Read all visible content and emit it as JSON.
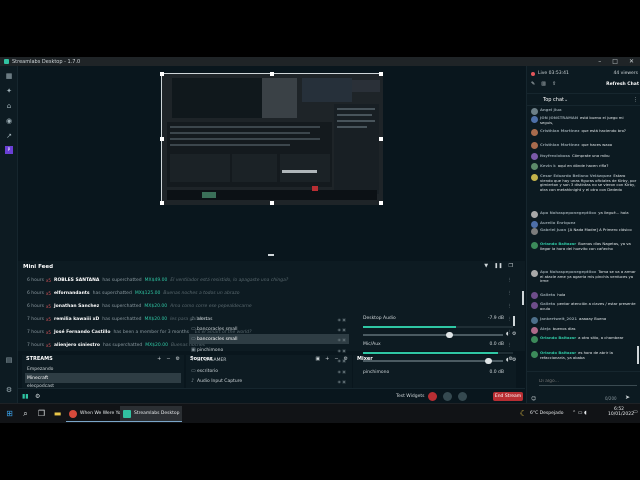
{
  "window": {
    "title": "Streamlabs Desktop - 1.7.0"
  },
  "leftnav": {
    "icons": [
      "editor-icon",
      "themes-icon",
      "store-icon",
      "record-icon",
      "stats-icon",
      "prime-icon",
      "chat-icon",
      "settings-icon"
    ]
  },
  "minifeed": {
    "title": "Mini Feed",
    "rows": [
      {
        "time": "6 hours",
        "badge": "x5",
        "name": "ROBLES SANTANA",
        "action": "has superchatted",
        "amount": "MX$49.00",
        "message": "El ventilador está resistido, lo apagaste una chinga?"
      },
      {
        "time": "6 hours",
        "badge": "x5",
        "name": "elfornandants",
        "action": "has superchatted",
        "amount": "MX$125.00",
        "message": "Buenas noches a todos un abrazo"
      },
      {
        "time": "6 hours",
        "badge": "x5",
        "name": "Jonathan Sanchez",
        "action": "has superchatted",
        "amount": "MX$20.00",
        "message": "Ama como corre ese pepealdecarne"
      },
      {
        "time": "7 hours",
        "badge": "x5",
        "name": "remilia kawaiii xD",
        "action": "has superchatted",
        "amount": "MX$20.00",
        "message": "les para galletas"
      },
      {
        "time": "7 hours",
        "badge": "x5",
        "name": "José Fernando Castillo",
        "action": "has been a member for 3 months",
        "amount": "",
        "message": "Es el Smart of the world?"
      },
      {
        "time": "7 hours",
        "badge": "x5",
        "name": "alienjero siniestro",
        "action": "has superchatted",
        "amount": "MX$20.00",
        "message": "Buenas noches"
      }
    ]
  },
  "scenes": {
    "title": "STREAMS",
    "items": [
      "Empezando",
      "Minecraft",
      "elecpodcast"
    ],
    "selected": 1
  },
  "sources": {
    "title": "Sources",
    "items": [
      "alertas",
      "bancoracles small",
      "bancoracles small",
      "pinchimono",
      "DL LAGAMER",
      "escritorio",
      "Audio Input Capture"
    ],
    "selected": 2
  },
  "mixer": {
    "title": "Mixer",
    "channels": [
      {
        "name": "Desktop Audio",
        "db": "-7.9 dB",
        "level": 0.62
      },
      {
        "name": "Mic/Aux",
        "db": "0.0 dB",
        "level": 0.9
      },
      {
        "name": "pinchimono",
        "db": "0.0 dB",
        "level": 0
      }
    ]
  },
  "bottombar": {
    "test_widgets": "Test Widgets",
    "end_stream": "End Stream"
  },
  "chat": {
    "live": "Live 03:53:41",
    "viewers": "44 viewers",
    "refresh": "Refresh Chat",
    "mode": "Top chat",
    "messages": [
      {
        "user": "Angel Jiua",
        "text": ""
      },
      {
        "user": "JON JONSTRAMAN",
        "text": "está bueno el juego mi seguis,"
      },
      {
        "user": "Cristhian Martinez",
        "text": "que está haciendo bro?"
      },
      {
        "user": "Cristhian Martinez",
        "text": "que haces waxo"
      },
      {
        "user": "itsyfrexixboss",
        "text": "Cómprate una miku"
      },
      {
        "user": "Kevin k",
        "text": "aquí en dónde hacen rifla?"
      },
      {
        "user": "Cesar Eduardo Bellano Velázquez",
        "text": "Estaro viendo que hay unas figuras oficiales de Kirby, por gimierton y son 3 distintas no se vieron con Kirby, otra con metahknight y el otro con Dededo"
      },
      {
        "user": "Apo Nohaspeponegeptilox",
        "text": "ya llegué... hola"
      },
      {
        "user": "Aurelio Enriquez",
        "text": ""
      },
      {
        "user": "Gabriel Juan",
        "text": "[A Nada Madre] A Primero clásico"
      },
      {
        "user": "Orlando Baltazar",
        "text": "Buenos días Nagetas, ya va llegar la hora del huevito con cañecho"
      },
      {
        "user": "Apo Nohaspeponegeptilox",
        "text": "Toma se va a armar el atacle ame ya agarria mis pinchis verduces ya irme"
      },
      {
        "user": "Galleta",
        "text": "hola"
      },
      {
        "user": "Galleta",
        "text": "pentar atención a claves / estar presente oculo"
      },
      {
        "user": "Jankertweit_2021",
        "text": "aaaaay Buena"
      },
      {
        "user": "Aleja",
        "text": "buenos días"
      },
      {
        "user": "Orlando Baltazar",
        "text": "a otro sitio, a chambear"
      },
      {
        "user": "Orlando Baltazar",
        "text": "es hora de abrir la refaccionaría, ya ababa"
      }
    ],
    "input_placeholder": "Di algo...",
    "char_count": "0/200"
  },
  "taskbar": {
    "apps": [
      {
        "label": "When We Were Yo...",
        "color": "#d64a3b"
      },
      {
        "label": "Streamlabs Desktop",
        "color": "#31c3a2"
      }
    ],
    "weather": "6°C Despejado",
    "time": "6:52",
    "date": "10/01/2022"
  }
}
